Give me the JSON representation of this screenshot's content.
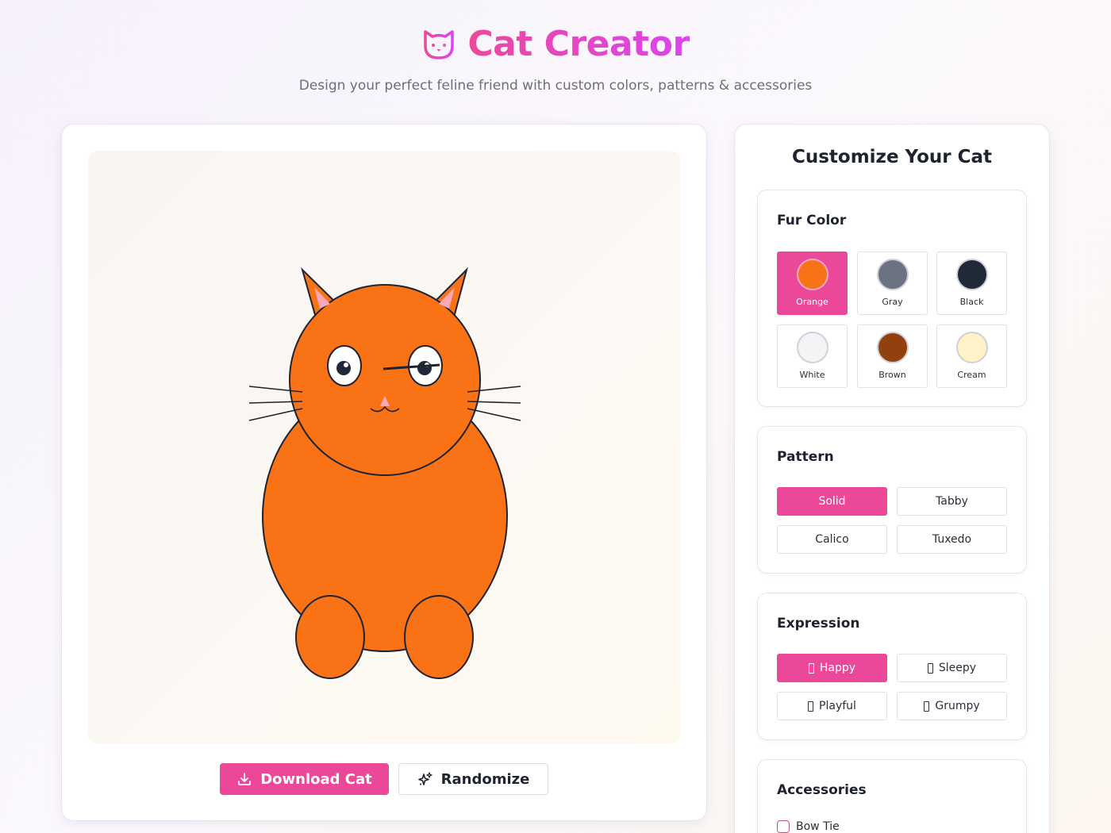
{
  "header": {
    "title": "Cat Creator",
    "subtitle": "Design your perfect feline friend with custom colors, patterns & accessories"
  },
  "preview": {
    "selected_fur_color": "#f97316",
    "actions": {
      "download_label": "Download Cat",
      "randomize_label": "Randomize"
    }
  },
  "controls": {
    "title": "Customize Your Cat",
    "fur_color": {
      "title": "Fur Color",
      "options": [
        {
          "label": "Orange",
          "color": "#f97316",
          "selected": true
        },
        {
          "label": "Gray",
          "color": "#6b7280",
          "selected": false
        },
        {
          "label": "Black",
          "color": "#1f2937",
          "selected": false
        },
        {
          "label": "White",
          "color": "#f3f4f6",
          "selected": false
        },
        {
          "label": "Brown",
          "color": "#92400e",
          "selected": false
        },
        {
          "label": "Cream",
          "color": "#fef3c7",
          "selected": false
        }
      ]
    },
    "pattern": {
      "title": "Pattern",
      "options": [
        {
          "label": "Solid",
          "selected": true
        },
        {
          "label": "Tabby",
          "selected": false
        },
        {
          "label": "Calico",
          "selected": false
        },
        {
          "label": "Tuxedo",
          "selected": false
        }
      ]
    },
    "expression": {
      "title": "Expression",
      "options": [
        {
          "label": "Happy",
          "selected": true
        },
        {
          "label": "Sleepy",
          "selected": false
        },
        {
          "label": "Playful",
          "selected": false
        },
        {
          "label": "Grumpy",
          "selected": false
        }
      ]
    },
    "accessories": {
      "title": "Accessories",
      "items": [
        {
          "label": "Bow Tie",
          "checked": false
        }
      ]
    }
  },
  "colors": {
    "accent": "#ec4899",
    "accent_gradient_end": "#d946ef"
  }
}
